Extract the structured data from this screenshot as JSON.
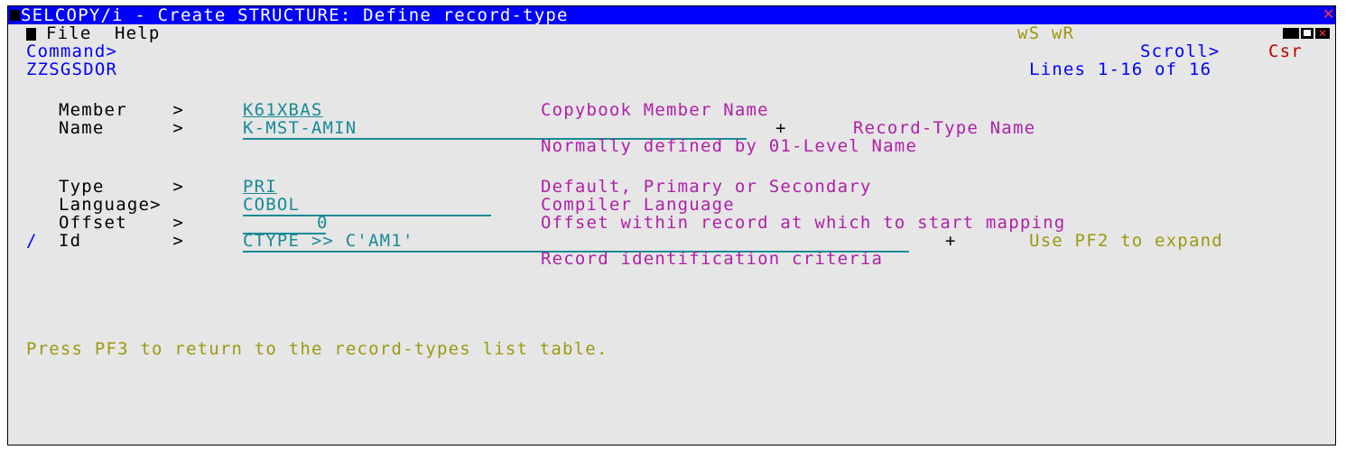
{
  "title_bar": {
    "title": "SELCOPY/i - Create STRUCTURE: Define record-type"
  },
  "menu": {
    "items": [
      "File",
      "Help"
    ],
    "ws_wr": "wS wR"
  },
  "command": {
    "label": "Command>",
    "scroll_label": "Scroll>",
    "scroll_value": "Csr"
  },
  "panel": {
    "id": "ZZSGSDOR",
    "lines": "Lines 1-16 of 16"
  },
  "fields": {
    "member": {
      "label": "Member    >",
      "value": "K61XBAS",
      "desc": "Copybook Member Name"
    },
    "name": {
      "label": "Name      >",
      "value": "K-MST-AMIN",
      "plus": "+",
      "desc": "Record-Type Name",
      "desc2": "Normally defined by 01-Level Name"
    },
    "type": {
      "label": "Type      >",
      "value": "PRI",
      "desc": "Default, Primary or Secondary"
    },
    "language": {
      "label": "Language>",
      "value": "COBOL",
      "desc": "Compiler Language"
    },
    "offset": {
      "label": "Offset    >",
      "value": "0",
      "desc": "Offset within record at which to start mapping"
    },
    "id": {
      "prefix": "/",
      "label": "Id        >",
      "value": "CTYPE >> C'AM1'",
      "plus": "+",
      "hint": "Use PF2 to expand",
      "desc": "Record identification criteria"
    }
  },
  "footer": {
    "message": "Press PF3 to return to the record-types list table."
  },
  "colors": {
    "background": "#e6e6e6",
    "title_bar": "#0000ff",
    "input": "#1a8a96",
    "description": "#b01fa8",
    "message": "#9a9a10",
    "alert": "#c00000"
  }
}
